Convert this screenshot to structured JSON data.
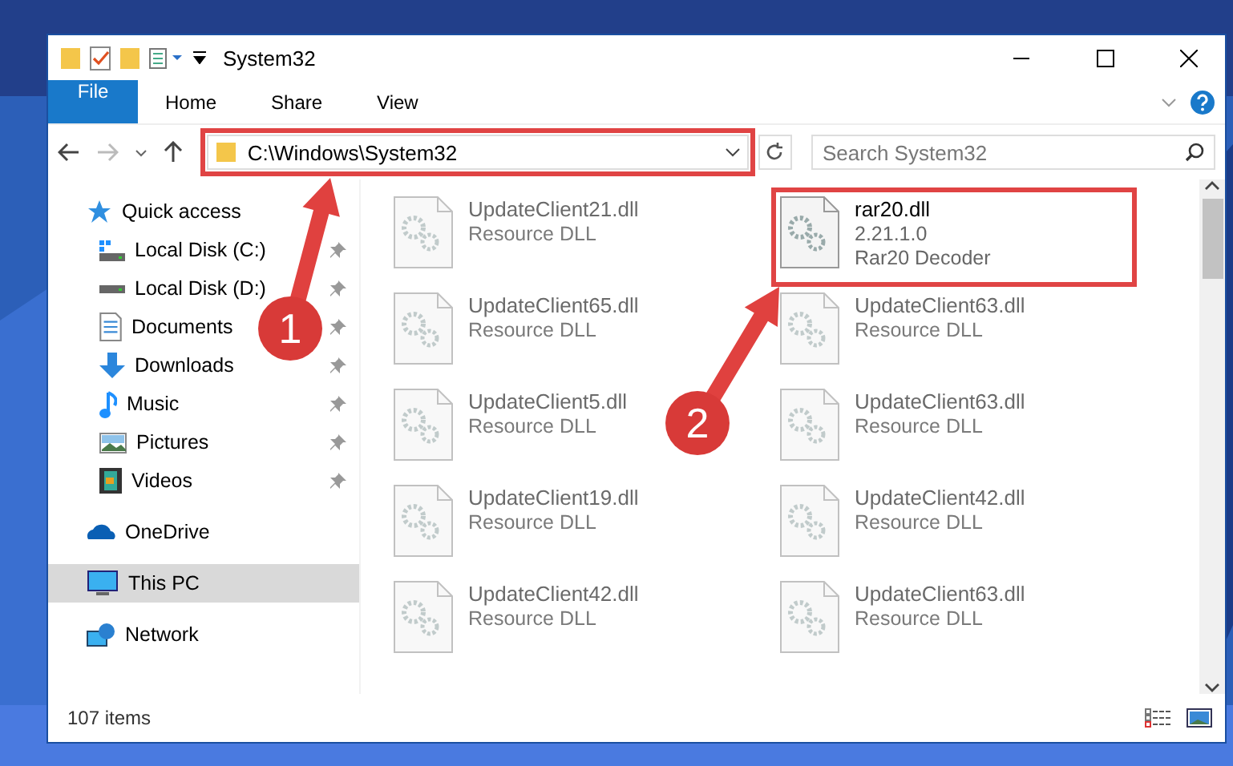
{
  "window": {
    "title": "System32"
  },
  "ribbon": {
    "tabs": [
      {
        "label": "File",
        "kind": "file",
        "selected": false
      },
      {
        "label": "Home",
        "kind": "tab",
        "selected": false
      },
      {
        "label": "Share",
        "kind": "tab",
        "selected": false
      },
      {
        "label": "View",
        "kind": "tab",
        "selected": false
      }
    ]
  },
  "address_bar": {
    "path": "C:\\Windows\\System32",
    "highlighted": true
  },
  "search": {
    "placeholder": "Search System32"
  },
  "navigation": [
    {
      "label": "Quick access",
      "selected": false,
      "children": [
        {
          "label": "Local Disk (C:)",
          "pinned": true,
          "selected": false
        },
        {
          "label": "Local Disk (D:)",
          "pinned": true,
          "selected": false
        },
        {
          "label": "Documents",
          "pinned": true,
          "selected": false
        },
        {
          "label": "Downloads",
          "pinned": true,
          "selected": false
        },
        {
          "label": "Music",
          "pinned": true,
          "selected": false
        },
        {
          "label": "Pictures",
          "pinned": true,
          "selected": false
        },
        {
          "label": "Videos",
          "pinned": true,
          "selected": false
        }
      ]
    },
    {
      "label": "OneDrive",
      "selected": false
    },
    {
      "label": "This PC",
      "selected": true
    },
    {
      "label": "Network",
      "selected": false
    }
  ],
  "files": [
    {
      "name": "UpdateClient21.dll",
      "details": [
        "Resource DLL"
      ],
      "blurred": true,
      "highlighted": false
    },
    {
      "name": "rar20.dll",
      "details": [
        "2.21.1.0",
        "Rar20 Decoder"
      ],
      "blurred": false,
      "highlighted": true
    },
    {
      "name": "UpdateClient65.dll",
      "details": [
        "Resource DLL"
      ],
      "blurred": true,
      "highlighted": false
    },
    {
      "name": "UpdateClient63.dll",
      "details": [
        "Resource DLL"
      ],
      "blurred": true,
      "highlighted": false
    },
    {
      "name": "UpdateClient5.dll",
      "details": [
        "Resource DLL"
      ],
      "blurred": true,
      "highlighted": false
    },
    {
      "name": "UpdateClient63.dll",
      "details": [
        "Resource DLL"
      ],
      "blurred": true,
      "highlighted": false
    },
    {
      "name": "UpdateClient19.dll",
      "details": [
        "Resource DLL"
      ],
      "blurred": true,
      "highlighted": false
    },
    {
      "name": "UpdateClient42.dll",
      "details": [
        "Resource DLL"
      ],
      "blurred": true,
      "highlighted": false
    },
    {
      "name": "UpdateClient42.dll",
      "details": [
        "Resource DLL"
      ],
      "blurred": true,
      "highlighted": false
    },
    {
      "name": "UpdateClient63.dll",
      "details": [
        "Resource DLL"
      ],
      "blurred": true,
      "highlighted": false
    }
  ],
  "status_bar": {
    "text": "107 items"
  },
  "callouts": [
    {
      "number": "1"
    },
    {
      "number": "2"
    }
  ]
}
